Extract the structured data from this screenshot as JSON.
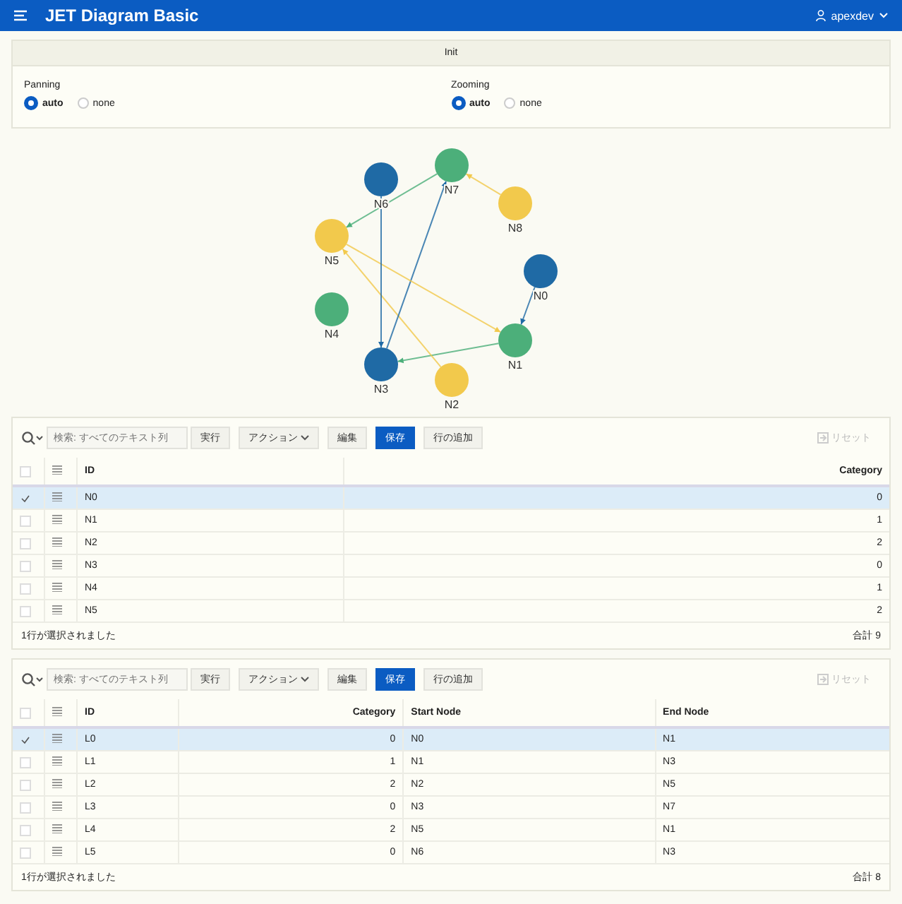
{
  "header": {
    "title": "JET Diagram Basic",
    "user": "apexdev"
  },
  "init": {
    "title": "Init",
    "groups": [
      {
        "label": "Panning",
        "options": [
          {
            "label": "auto",
            "selected": true
          },
          {
            "label": "none",
            "selected": false
          }
        ]
      },
      {
        "label": "Zooming",
        "options": [
          {
            "label": "auto",
            "selected": true
          },
          {
            "label": "none",
            "selected": false
          }
        ]
      }
    ]
  },
  "diagram": {
    "nodes": [
      {
        "label": "N0",
        "color": "#1f6aa5"
      },
      {
        "label": "N1",
        "color": "#4caf7a"
      },
      {
        "label": "N2",
        "color": "#f2c94c"
      },
      {
        "label": "N3",
        "color": "#1f6aa5"
      },
      {
        "label": "N4",
        "color": "#4caf7a"
      },
      {
        "label": "N5",
        "color": "#f2c94c"
      },
      {
        "label": "N6",
        "color": "#1f6aa5"
      },
      {
        "label": "N7",
        "color": "#4caf7a"
      },
      {
        "label": "N8",
        "color": "#f2c94c"
      }
    ]
  },
  "grids": [
    {
      "toolbar": {
        "placeholder": "検索: すべてのテキスト列",
        "go": "実行",
        "actions": "アクション",
        "edit": "編集",
        "save": "保存",
        "add_row": "行の追加",
        "reset": "リセット"
      },
      "select_all_checked": false,
      "columns": [
        {
          "label": "ID",
          "kind": "text"
        },
        {
          "label": "Category",
          "kind": "number"
        }
      ],
      "rows": [
        {
          "selected": true,
          "cells": [
            "N0",
            "0"
          ]
        },
        {
          "selected": false,
          "cells": [
            "N1",
            "1"
          ]
        },
        {
          "selected": false,
          "cells": [
            "N2",
            "2"
          ]
        },
        {
          "selected": false,
          "cells": [
            "N3",
            "0"
          ]
        },
        {
          "selected": false,
          "cells": [
            "N4",
            "1"
          ]
        },
        {
          "selected": false,
          "cells": [
            "N5",
            "2"
          ]
        }
      ],
      "status": "1行が選択されました",
      "total": "合計 9"
    },
    {
      "toolbar": {
        "placeholder": "検索: すべてのテキスト列",
        "go": "実行",
        "actions": "アクション",
        "edit": "編集",
        "save": "保存",
        "add_row": "行の追加",
        "reset": "リセット"
      },
      "select_all_checked": false,
      "columns": [
        {
          "label": "ID",
          "kind": "text"
        },
        {
          "label": "Category",
          "kind": "number"
        },
        {
          "label": "Start Node",
          "kind": "text"
        },
        {
          "label": "End Node",
          "kind": "text"
        }
      ],
      "rows": [
        {
          "selected": true,
          "cells": [
            "L0",
            "0",
            "N0",
            "N1"
          ]
        },
        {
          "selected": false,
          "cells": [
            "L1",
            "1",
            "N1",
            "N3"
          ]
        },
        {
          "selected": false,
          "cells": [
            "L2",
            "2",
            "N2",
            "N5"
          ]
        },
        {
          "selected": false,
          "cells": [
            "L3",
            "0",
            "N3",
            "N7"
          ]
        },
        {
          "selected": false,
          "cells": [
            "L4",
            "2",
            "N5",
            "N1"
          ]
        },
        {
          "selected": false,
          "cells": [
            "L5",
            "0",
            "N6",
            "N3"
          ]
        }
      ],
      "status": "1行が選択されました",
      "total": "合計 8"
    }
  ]
}
